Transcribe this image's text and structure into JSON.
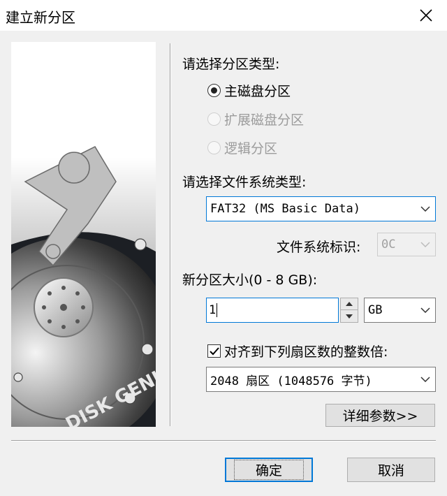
{
  "window": {
    "title": "建立新分区"
  },
  "partition_type": {
    "label": "请选择分区类型:",
    "options": [
      {
        "label": "主磁盘分区",
        "checked": true,
        "enabled": true
      },
      {
        "label": "扩展磁盘分区",
        "checked": false,
        "enabled": false
      },
      {
        "label": "逻辑分区",
        "checked": false,
        "enabled": false
      }
    ]
  },
  "filesystem": {
    "label": "请选择文件系统类型:",
    "selected": "FAT32 (MS Basic Data)",
    "id_label": "文件系统标识:",
    "id_value": "0C"
  },
  "size": {
    "label": "新分区大小(0 - 8 GB):",
    "value": "1",
    "unit": "GB"
  },
  "align": {
    "checked": true,
    "label": "对齐到下列扇区数的整数倍:",
    "selected": "2048 扇区 (1048576 字节)"
  },
  "buttons": {
    "details": "详细参数>>",
    "ok": "确定",
    "cancel": "取消"
  },
  "image": {
    "brand_text": "DISK GENIUS"
  },
  "icons": {
    "close": "close-icon",
    "dropdown": "chevron-down-icon",
    "spin_up": "spin-up-icon",
    "spin_down": "spin-down-icon",
    "check": "checkmark-icon"
  }
}
